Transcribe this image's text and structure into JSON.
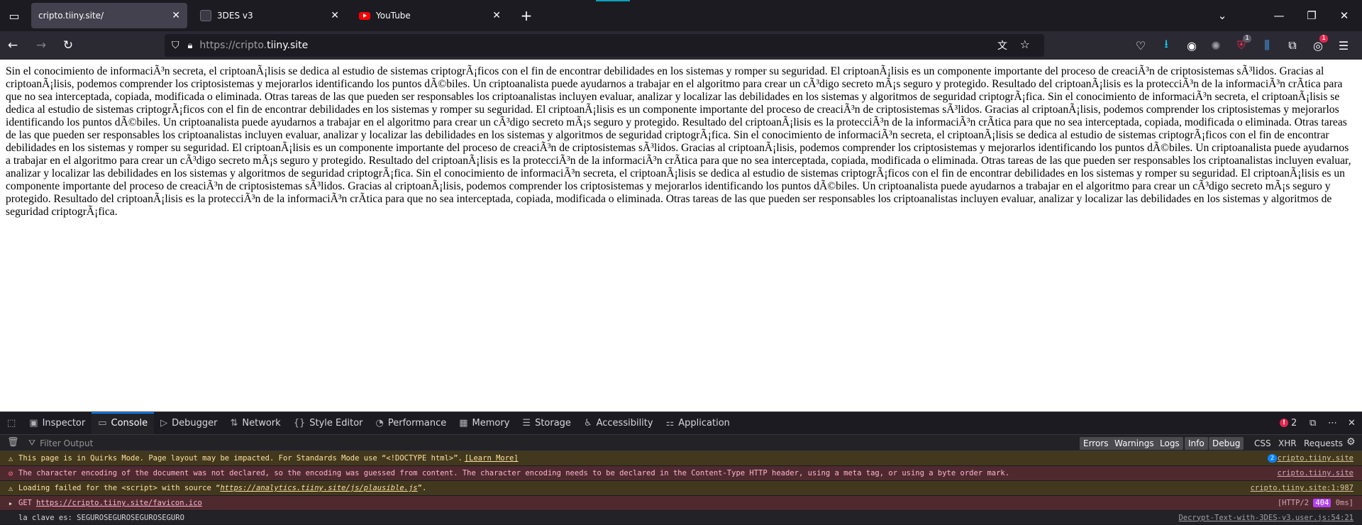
{
  "browser": {
    "tabs": [
      {
        "label": "cripto.tiiny.site/",
        "active": true
      },
      {
        "label": "3DES v3",
        "active": false
      },
      {
        "label": "YouTube",
        "active": false
      }
    ],
    "url": {
      "scheme": "https://cripto.",
      "host": "tiiny.site"
    },
    "toolbar_badges": {
      "ublock": "1",
      "ext": "1"
    }
  },
  "page": {
    "text": "Sin el conocimiento de informaciÃ³n secreta, el criptoanÃ¡lisis se dedica al estudio de sistemas criptogrÃ¡ficos con el fin de encontrar debilidades en los sistemas y romper su seguridad. El criptoanÃ¡lisis es un componente importante del proceso de creaciÃ³n de criptosistemas sÃ³lidos. Gracias al criptoanÃ¡lisis, podemos comprender los criptosistemas y mejorarlos identificando los puntos dÃ©biles. Un criptoanalista puede ayudarnos a trabajar en el algoritmo para crear un cÃ³digo secreto mÃ¡s seguro y protegido. Resultado del criptoanÃ¡lisis es la protecciÃ³n de la informaciÃ³n crÃ­tica para que no sea interceptada, copiada, modificada o eliminada. Otras tareas de las que pueden ser responsables los criptoanalistas incluyen evaluar, analizar y localizar las debilidades en los sistemas y algoritmos de seguridad criptogrÃ¡fica. Sin el conocimiento de informaciÃ³n secreta, el criptoanÃ¡lisis se dedica al estudio de sistemas criptogrÃ¡ficos con el fin de encontrar debilidades en los sistemas y romper su seguridad. El criptoanÃ¡lisis es un componente importante del proceso de creaciÃ³n de criptosistemas sÃ³lidos. Gracias al criptoanÃ¡lisis, podemos comprender los criptosistemas y mejorarlos identificando los puntos dÃ©biles. Un criptoanalista puede ayudarnos a trabajar en el algoritmo para crear un cÃ³digo secreto mÃ¡s seguro y protegido. Resultado del criptoanÃ¡lisis es la protecciÃ³n de la informaciÃ³n crÃ­tica para que no sea interceptada, copiada, modificada o eliminada. Otras tareas de las que pueden ser responsables los criptoanalistas incluyen evaluar, analizar y localizar las debilidades en los sistemas y algoritmos de seguridad criptogrÃ¡fica. Sin el conocimiento de informaciÃ³n secreta, el criptoanÃ¡lisis se dedica al estudio de sistemas criptogrÃ¡ficos con el fin de encontrar debilidades en los sistemas y romper su seguridad. El criptoanÃ¡lisis es un componente importante del proceso de creaciÃ³n de criptosistemas sÃ³lidos. Gracias al criptoanÃ¡lisis, podemos comprender los criptosistemas y mejorarlos identificando los puntos dÃ©biles. Un criptoanalista puede ayudarnos a trabajar en el algoritmo para crear un cÃ³digo secreto mÃ¡s seguro y protegido. Resultado del criptoanÃ¡lisis es la protecciÃ³n de la informaciÃ³n crÃ­tica para que no sea interceptada, copiada, modificada o eliminada. Otras tareas de las que pueden ser responsables los criptoanalistas incluyen evaluar, analizar y localizar las debilidades en los sistemas y algoritmos de seguridad criptogrÃ¡fica. Sin el conocimiento de informaciÃ³n secreta, el criptoanÃ¡lisis se dedica al estudio de sistemas criptogrÃ¡ficos con el fin de encontrar debilidades en los sistemas y romper su seguridad. El criptoanÃ¡lisis es un componente importante del proceso de creaciÃ³n de criptosistemas sÃ³lidos. Gracias al criptoanÃ¡lisis, podemos comprender los criptosistemas y mejorarlos identificando los puntos dÃ©biles. Un criptoanalista puede ayudarnos a trabajar en el algoritmo para crear un cÃ³digo secreto mÃ¡s seguro y protegido. Resultado del criptoanÃ¡lisis es la protecciÃ³n de la informaciÃ³n crÃ­tica para que no sea interceptada, copiada, modificada o eliminada. Otras tareas de las que pueden ser responsables los criptoanalistas incluyen evaluar, analizar y localizar las debilidades en los sistemas y algoritmos de seguridad criptogrÃ¡fica."
  },
  "devtools": {
    "tabs": [
      "Inspector",
      "Console",
      "Debugger",
      "Network",
      "Style Editor",
      "Performance",
      "Memory",
      "Storage",
      "Accessibility",
      "Application"
    ],
    "error_count": "2",
    "filter_placeholder": "Filter Output",
    "filters": [
      "Errors",
      "Warnings",
      "Logs",
      "Info",
      "Debug"
    ],
    "extra_filters": [
      "CSS",
      "XHR",
      "Requests"
    ],
    "messages": {
      "m1": {
        "text": "This page is in Quirks Mode. Page layout may be impacted. For Standards Mode use “<!DOCTYPE html>”.",
        "link": "[Learn More]",
        "repeat": "2",
        "source": "cripto.tiiny.site"
      },
      "m2": {
        "text": "The character encoding of the document was not declared, so the encoding was guessed from content. The character encoding needs to be declared in the Content-Type HTTP header, using a meta tag, or using a byte order mark.",
        "source": "cripto.tiiny.site"
      },
      "m3": {
        "prefix": "Loading failed for the <script> with source “",
        "url": "https://analytics.tiiny.site/js/plausible.js",
        "suffix": "”.",
        "source": "cripto.tiiny.site:1:987"
      },
      "m4": {
        "method": "GET",
        "url": "https://cripto.tiiny.site/favicon.ico",
        "proto": "[HTTP/2",
        "status": "404",
        "time": "0ms]"
      },
      "m5": {
        "text": "la clave es: SEGUROSEGUROSEGUROSEGURO",
        "source": "Decrypt-Text-with-3DES-v3.user.js:54:21"
      }
    }
  }
}
